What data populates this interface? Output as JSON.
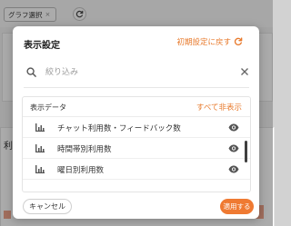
{
  "background": {
    "chip_label": "グラフ選択",
    "chip_close": "×",
    "side_label": "利用"
  },
  "dialog": {
    "title": "表示設定",
    "reset_label": "初期設定に戻す",
    "search": {
      "placeholder": "絞り込み",
      "value": ""
    },
    "panel": {
      "title": "表示データ",
      "hide_all_label": "すべて非表示",
      "rows": [
        {
          "label": "チャット利用数・フィードバック数",
          "icon": "bar-chart-icon",
          "visibility_icon": "eye-icon"
        },
        {
          "label": "時間帯別利用数",
          "icon": "bar-chart-icon",
          "visibility_icon": "eye-icon"
        },
        {
          "label": "曜日別利用数",
          "icon": "bar-chart-icon",
          "visibility_icon": "eye-icon"
        }
      ]
    },
    "cancel_label": "キャンセル",
    "apply_label": "適用する"
  },
  "colors": {
    "accent": "#ef7a32",
    "link": "#e87b2e",
    "chart_bar_bg": "#f1a58b"
  }
}
